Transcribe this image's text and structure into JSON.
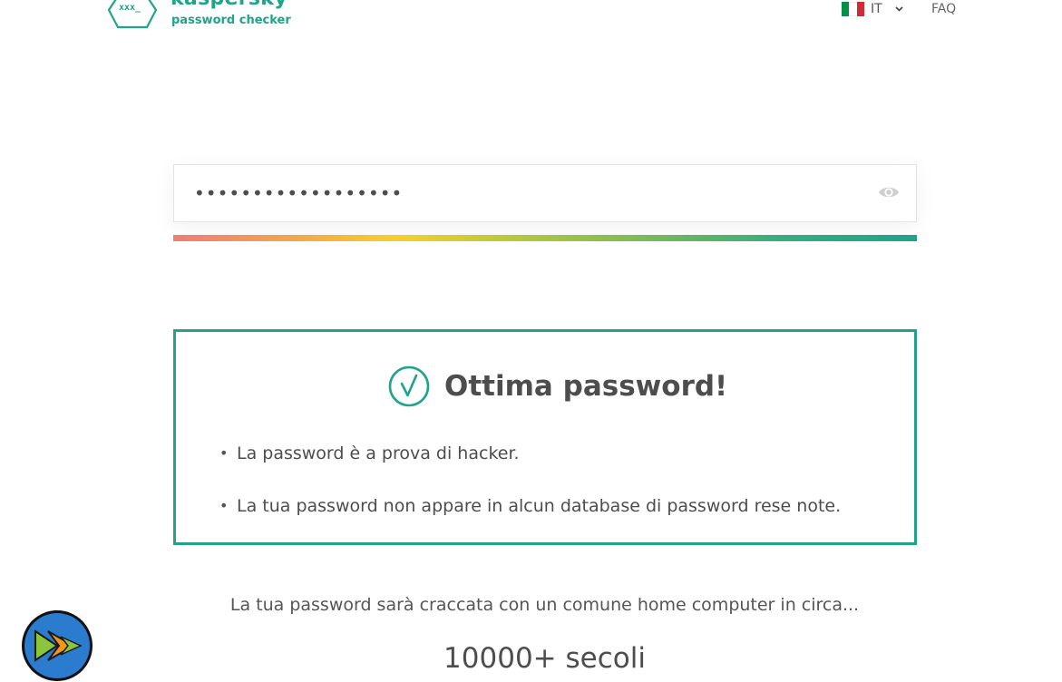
{
  "header": {
    "brand": "kaspersky",
    "product": "password checker",
    "logo_marks": "xxx_",
    "language": {
      "code": "IT",
      "flag_colors": [
        "#009246",
        "#ffffff",
        "#ce2b37"
      ]
    },
    "faq_label": "FAQ"
  },
  "password": {
    "value": "••••••••••••••••••",
    "visibility_icon": "eye-icon",
    "strength_level": 1.0
  },
  "result": {
    "icon": "check-circle-icon",
    "title": "Ottima password!",
    "bullets": [
      "La password è a prova di hacker.",
      "La tua password non appare in alcun database di password rese note."
    ]
  },
  "crack_time": {
    "label": "La tua password sarà craccata con un comune home computer in circa...",
    "value": "10000+ secoli"
  },
  "floating_badge": {
    "icon": "play-badge-icon"
  },
  "colors": {
    "accent": "#1fa48a",
    "text": "#4d4d4d"
  }
}
